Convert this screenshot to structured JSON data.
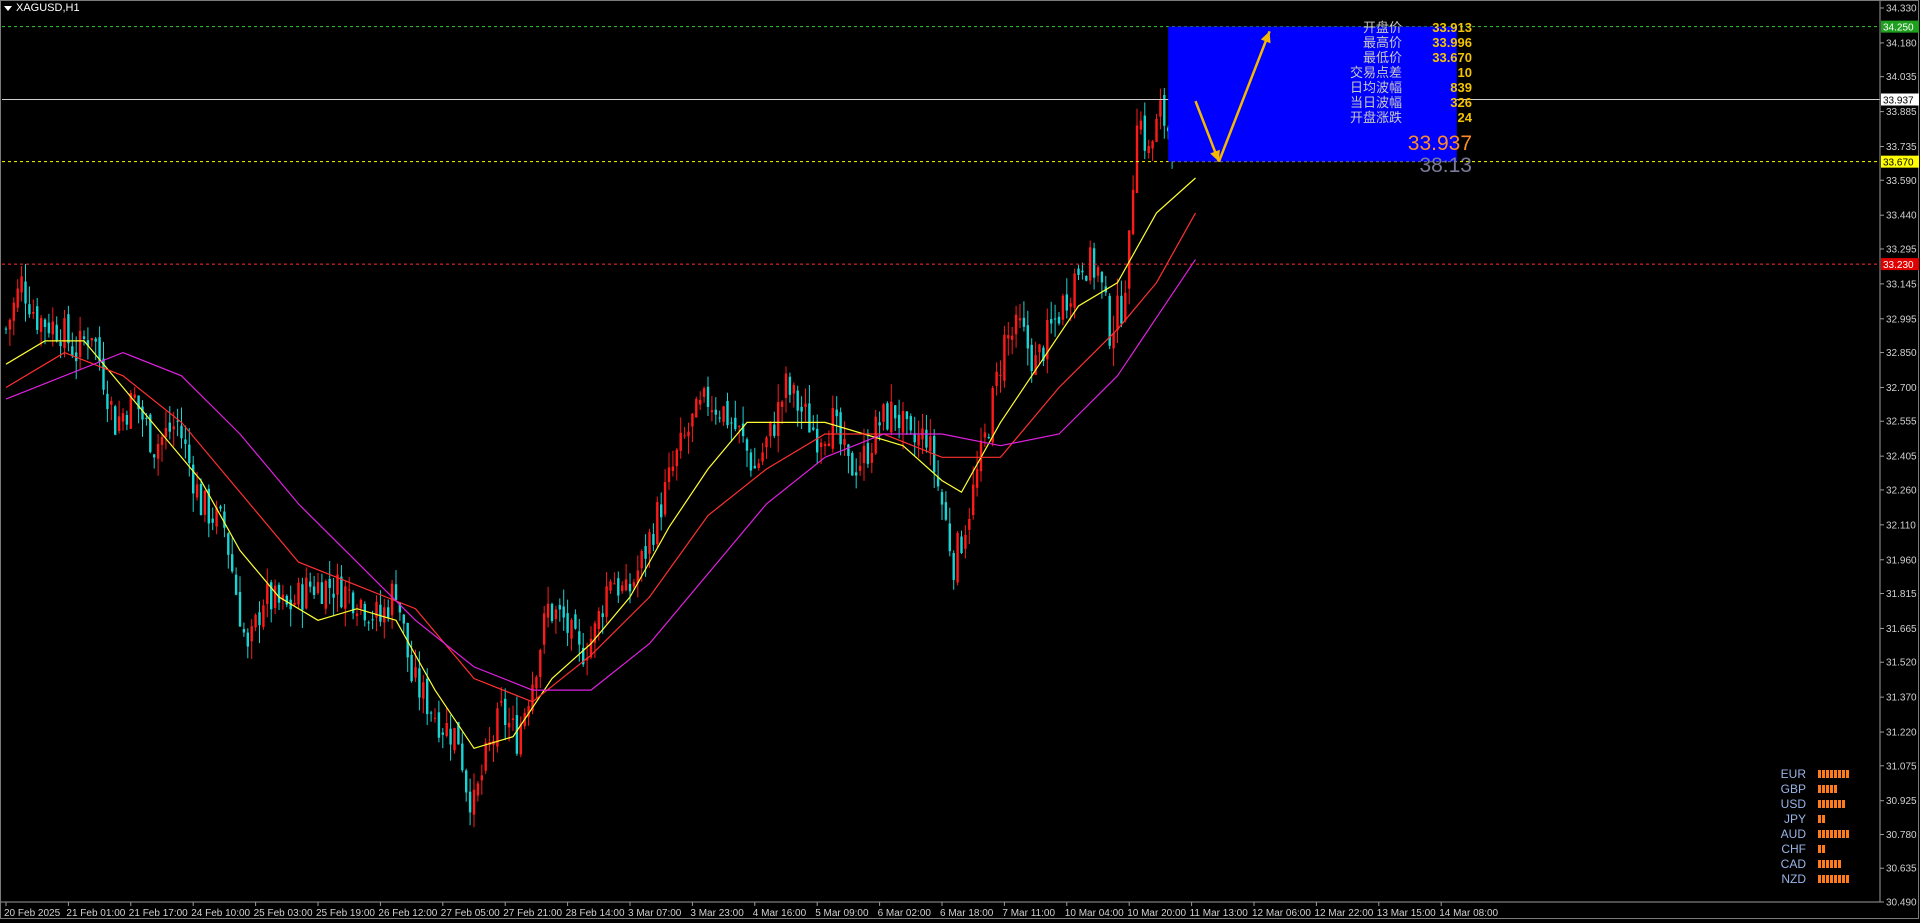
{
  "symbol_label": "XAGUSD,H1",
  "info_panel": [
    {
      "label": "开盘价",
      "value": "33.913"
    },
    {
      "label": "最高价",
      "value": "33.996"
    },
    {
      "label": "最低价",
      "value": "33.670"
    },
    {
      "label": "交易点差",
      "value": "10"
    },
    {
      "label": "日均波幅",
      "value": "839"
    },
    {
      "label": "当日波幅",
      "value": "326"
    },
    {
      "label": "开盘涨跌",
      "value": "24"
    }
  ],
  "current_price": "33.937",
  "countdown": "38:13",
  "price_tags": {
    "resistance": "34.250",
    "current": "33.937",
    "support": "33.670",
    "lower_line": "33.230"
  },
  "currency_strength": [
    {
      "currency": "EUR",
      "level": 8
    },
    {
      "currency": "GBP",
      "level": 5
    },
    {
      "currency": "USD",
      "level": 7
    },
    {
      "currency": "JPY",
      "level": 2
    },
    {
      "currency": "AUD",
      "level": 8
    },
    {
      "currency": "CHF",
      "level": 2
    },
    {
      "currency": "CAD",
      "level": 6
    },
    {
      "currency": "NZD",
      "level": 8
    }
  ],
  "colors": {
    "background": "#000000",
    "bull": "#ff1a1a",
    "bear": "#1ad4d4",
    "ma_fast": "#ffff33",
    "ma_mid": "#ff3030",
    "ma_slow": "#e020e0",
    "resistance": "#33cc33",
    "support": "#ffff00",
    "lower_line": "#ff3030",
    "box": "#0000ff",
    "arrow": "#f5b800"
  },
  "chart_data": {
    "type": "line",
    "y_axis_ticks": [
      "34.330",
      "34.180",
      "34.035",
      "33.885",
      "33.735",
      "33.590",
      "33.440",
      "33.295",
      "33.145",
      "32.995",
      "32.850",
      "32.700",
      "32.555",
      "32.405",
      "32.260",
      "32.110",
      "31.960",
      "31.815",
      "31.665",
      "31.520",
      "31.370",
      "31.220",
      "31.075",
      "30.925",
      "30.780",
      "30.635",
      "30.490"
    ],
    "ylim": [
      30.49,
      34.33
    ],
    "x_axis_ticks": [
      "20 Feb 2025",
      "21 Feb 01:00",
      "21 Feb 17:00",
      "24 Feb 10:00",
      "25 Feb 03:00",
      "25 Feb 19:00",
      "26 Feb 12:00",
      "27 Feb 05:00",
      "27 Feb 21:00",
      "28 Feb 14:00",
      "3 Mar 07:00",
      "3 Mar 23:00",
      "4 Mar 16:00",
      "5 Mar 09:00",
      "6 Mar 02:00",
      "6 Mar 18:00",
      "7 Mar 11:00",
      "10 Mar 04:00",
      "10 Mar 20:00",
      "11 Mar 13:00",
      "12 Mar 06:00",
      "12 Mar 22:00",
      "13 Mar 15:00",
      "14 Mar 08:00"
    ],
    "bars_per_tick": 16,
    "close_path": [
      [
        0,
        32.95
      ],
      [
        4,
        33.15
      ],
      [
        8,
        33.0
      ],
      [
        14,
        32.95
      ],
      [
        18,
        32.85
      ],
      [
        22,
        32.95
      ],
      [
        28,
        32.55
      ],
      [
        33,
        32.65
      ],
      [
        38,
        32.45
      ],
      [
        44,
        32.55
      ],
      [
        50,
        32.2
      ],
      [
        56,
        32.1
      ],
      [
        62,
        31.55
      ],
      [
        66,
        31.8
      ],
      [
        72,
        31.75
      ],
      [
        78,
        31.85
      ],
      [
        84,
        31.85
      ],
      [
        90,
        31.8
      ],
      [
        96,
        31.7
      ],
      [
        100,
        31.85
      ],
      [
        104,
        31.45
      ],
      [
        108,
        31.35
      ],
      [
        112,
        31.25
      ],
      [
        116,
        31.2
      ],
      [
        118,
        31.0
      ],
      [
        120,
        30.9
      ],
      [
        123,
        31.1
      ],
      [
        127,
        31.3
      ],
      [
        131,
        31.2
      ],
      [
        135,
        31.45
      ],
      [
        139,
        31.75
      ],
      [
        143,
        31.7
      ],
      [
        147,
        31.55
      ],
      [
        151,
        31.65
      ],
      [
        155,
        31.9
      ],
      [
        159,
        31.8
      ],
      [
        163,
        31.95
      ],
      [
        168,
        32.2
      ],
      [
        172,
        32.4
      ],
      [
        176,
        32.55
      ],
      [
        180,
        32.65
      ],
      [
        184,
        32.6
      ],
      [
        188,
        32.5
      ],
      [
        192,
        32.35
      ],
      [
        196,
        32.5
      ],
      [
        200,
        32.7
      ],
      [
        204,
        32.6
      ],
      [
        208,
        32.5
      ],
      [
        212,
        32.55
      ],
      [
        216,
        32.35
      ],
      [
        220,
        32.4
      ],
      [
        224,
        32.55
      ],
      [
        228,
        32.6
      ],
      [
        232,
        32.45
      ],
      [
        236,
        32.5
      ],
      [
        240,
        32.2
      ],
      [
        243,
        31.95
      ],
      [
        245,
        32.05
      ],
      [
        248,
        32.25
      ],
      [
        252,
        32.55
      ],
      [
        256,
        32.9
      ],
      [
        260,
        32.95
      ],
      [
        264,
        32.8
      ],
      [
        268,
        32.95
      ],
      [
        272,
        33.1
      ],
      [
        276,
        33.25
      ],
      [
        280,
        33.2
      ],
      [
        283,
        32.95
      ],
      [
        286,
        33.05
      ],
      [
        288,
        33.3
      ],
      [
        290,
        33.9
      ],
      [
        293,
        33.7
      ],
      [
        296,
        33.88
      ],
      [
        299,
        33.78
      ],
      [
        302,
        33.92
      ],
      [
        305,
        33.94
      ]
    ],
    "ma_fast": {
      "period_hint": "fast",
      "path": [
        [
          0,
          32.8
        ],
        [
          10,
          32.9
        ],
        [
          20,
          32.9
        ],
        [
          30,
          32.7
        ],
        [
          40,
          32.5
        ],
        [
          50,
          32.3
        ],
        [
          60,
          32.0
        ],
        [
          70,
          31.8
        ],
        [
          80,
          31.7
        ],
        [
          90,
          31.75
        ],
        [
          100,
          31.7
        ],
        [
          110,
          31.4
        ],
        [
          120,
          31.15
        ],
        [
          130,
          31.2
        ],
        [
          140,
          31.45
        ],
        [
          150,
          31.6
        ],
        [
          160,
          31.8
        ],
        [
          170,
          32.1
        ],
        [
          180,
          32.35
        ],
        [
          190,
          32.55
        ],
        [
          200,
          32.55
        ],
        [
          210,
          32.55
        ],
        [
          220,
          32.5
        ],
        [
          230,
          32.45
        ],
        [
          240,
          32.3
        ],
        [
          245,
          32.25
        ],
        [
          255,
          32.55
        ],
        [
          265,
          32.8
        ],
        [
          275,
          33.05
        ],
        [
          285,
          33.15
        ],
        [
          295,
          33.45
        ],
        [
          305,
          33.6
        ]
      ]
    },
    "ma_mid": {
      "period_hint": "medium",
      "path": [
        [
          0,
          32.7
        ],
        [
          15,
          32.85
        ],
        [
          30,
          32.75
        ],
        [
          45,
          32.55
        ],
        [
          60,
          32.25
        ],
        [
          75,
          31.95
        ],
        [
          90,
          31.85
        ],
        [
          105,
          31.75
        ],
        [
          120,
          31.45
        ],
        [
          135,
          31.35
        ],
        [
          150,
          31.55
        ],
        [
          165,
          31.8
        ],
        [
          180,
          32.15
        ],
        [
          195,
          32.35
        ],
        [
          210,
          32.5
        ],
        [
          225,
          32.5
        ],
        [
          240,
          32.4
        ],
        [
          255,
          32.4
        ],
        [
          270,
          32.7
        ],
        [
          285,
          32.95
        ],
        [
          295,
          33.15
        ],
        [
          305,
          33.45
        ]
      ]
    },
    "ma_slow": {
      "period_hint": "slow",
      "path": [
        [
          0,
          32.65
        ],
        [
          15,
          32.75
        ],
        [
          30,
          32.85
        ],
        [
          45,
          32.75
        ],
        [
          60,
          32.5
        ],
        [
          75,
          32.2
        ],
        [
          90,
          31.95
        ],
        [
          105,
          31.7
        ],
        [
          120,
          31.5
        ],
        [
          135,
          31.4
        ],
        [
          150,
          31.4
        ],
        [
          165,
          31.6
        ],
        [
          180,
          31.9
        ],
        [
          195,
          32.2
        ],
        [
          210,
          32.4
        ],
        [
          225,
          32.5
        ],
        [
          240,
          32.5
        ],
        [
          255,
          32.45
        ],
        [
          270,
          32.5
        ],
        [
          285,
          32.75
        ],
        [
          295,
          33.0
        ],
        [
          305,
          33.25
        ]
      ]
    },
    "horizontal_lines": [
      {
        "value": 34.25,
        "style": "dashed",
        "role": "resistance"
      },
      {
        "value": 33.937,
        "style": "solid",
        "role": "current"
      },
      {
        "value": 33.67,
        "style": "dashed",
        "role": "support"
      },
      {
        "value": 33.23,
        "style": "dashed",
        "role": "lower_line"
      }
    ],
    "projection_box": {
      "x_start": 298,
      "x_end": 372,
      "y_top": 34.25,
      "y_bottom": 33.67
    },
    "projection_arrows": [
      {
        "from": [
          305,
          33.93
        ],
        "to": [
          311,
          33.67
        ]
      },
      {
        "from": [
          311,
          33.67
        ],
        "to": [
          324,
          34.23
        ]
      }
    ],
    "grid": false,
    "legend": "none"
  }
}
